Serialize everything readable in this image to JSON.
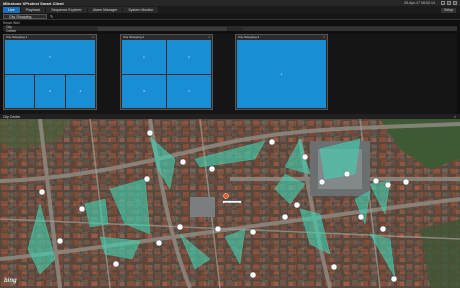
{
  "window": {
    "title": "Milestone XProtect Smart Client",
    "datetime": "25-Apr-17 08:02:14",
    "minimize": "–",
    "maximize": "□",
    "close": "×"
  },
  "tabs": [
    {
      "label": "Live"
    },
    {
      "label": "Playback"
    },
    {
      "label": "Sequence Explorer"
    },
    {
      "label": "Alarm Manager"
    },
    {
      "label": "System Monitor"
    }
  ],
  "setup_label": "Setup",
  "toolbar": {
    "view_name": "City Shopping",
    "edit_icon": "pencil-icon"
  },
  "group": {
    "section_label": "Smart Wall",
    "selected": "City Centre"
  },
  "camera_views": [
    {
      "title": "City Shopping 1",
      "cells": [
        "1",
        "",
        "3",
        "4"
      ]
    },
    {
      "title": "City Shopping 2",
      "cells": [
        "1",
        "2",
        "3",
        "4"
      ]
    },
    {
      "title": "City Shopping 3",
      "cells": [
        "1"
      ]
    }
  ],
  "map": {
    "title": "City Centre",
    "center_label": "City Centre",
    "provider": "bing",
    "colors": {
      "fov": "#3fd6b4",
      "pin": "#ffffff",
      "center_pin": "#e05a2a"
    }
  }
}
